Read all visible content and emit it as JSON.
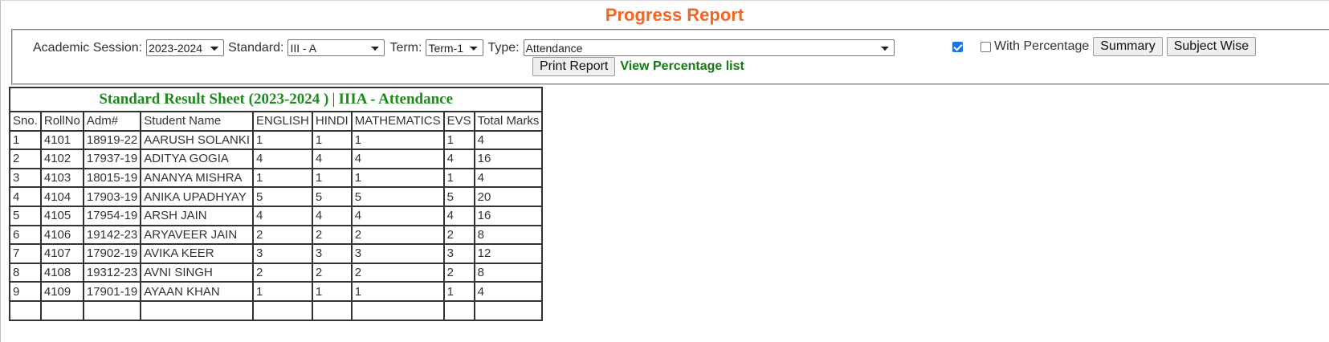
{
  "page": {
    "title": "Progress Report"
  },
  "filters": {
    "session_label": "Academic Session:",
    "session_value": "2023-2024",
    "standard_label": "Standard:",
    "standard_value": "III - A",
    "term_label": "Term:",
    "term_value": "Term-1",
    "type_label": "Type:",
    "type_value": "Attendance",
    "checkbox1_checked": true,
    "with_percentage_label": "With Percentage",
    "with_percentage_checked": false,
    "summary_label": "Summary",
    "subject_wise_label": "Subject Wise",
    "print_report_label": "Print Report",
    "view_percentage_label": "View Percentage list"
  },
  "sheet": {
    "title_left": "Standard Result Sheet (2023-2024 )",
    "separator": "|",
    "title_right": "IIIA - Attendance",
    "columns": [
      "Sno.",
      "RollNo",
      "Adm#",
      "Student Name",
      "ENGLISH",
      "HINDI",
      "MATHEMATICS",
      "EVS",
      "Total Marks"
    ],
    "rows": [
      [
        "1",
        "4101",
        "18919-22",
        "AARUSH SOLANKI",
        "1",
        "1",
        "1",
        "1",
        "4"
      ],
      [
        "2",
        "4102",
        "17937-19",
        "ADITYA GOGIA",
        "4",
        "4",
        "4",
        "4",
        "16"
      ],
      [
        "3",
        "4103",
        "18015-19",
        "ANANYA MISHRA",
        "1",
        "1",
        "1",
        "1",
        "4"
      ],
      [
        "4",
        "4104",
        "17903-19",
        "ANIKA UPADHYAY",
        "5",
        "5",
        "5",
        "5",
        "20"
      ],
      [
        "5",
        "4105",
        "17954-19",
        "ARSH JAIN",
        "4",
        "4",
        "4",
        "4",
        "16"
      ],
      [
        "6",
        "4106",
        "19142-23",
        "ARYAVEER JAIN",
        "2",
        "2",
        "2",
        "2",
        "8"
      ],
      [
        "7",
        "4107",
        "17902-19",
        "AVIKA KEER",
        "3",
        "3",
        "3",
        "3",
        "12"
      ],
      [
        "8",
        "4108",
        "19312-23",
        "AVNI SINGH",
        "2",
        "2",
        "2",
        "2",
        "8"
      ],
      [
        "9",
        "4109",
        "17901-19",
        "AYAAN KHAN",
        "1",
        "1",
        "1",
        "1",
        "4"
      ],
      [
        "",
        "",
        "",
        "",
        "",
        "",
        "",
        "",
        ""
      ]
    ]
  }
}
